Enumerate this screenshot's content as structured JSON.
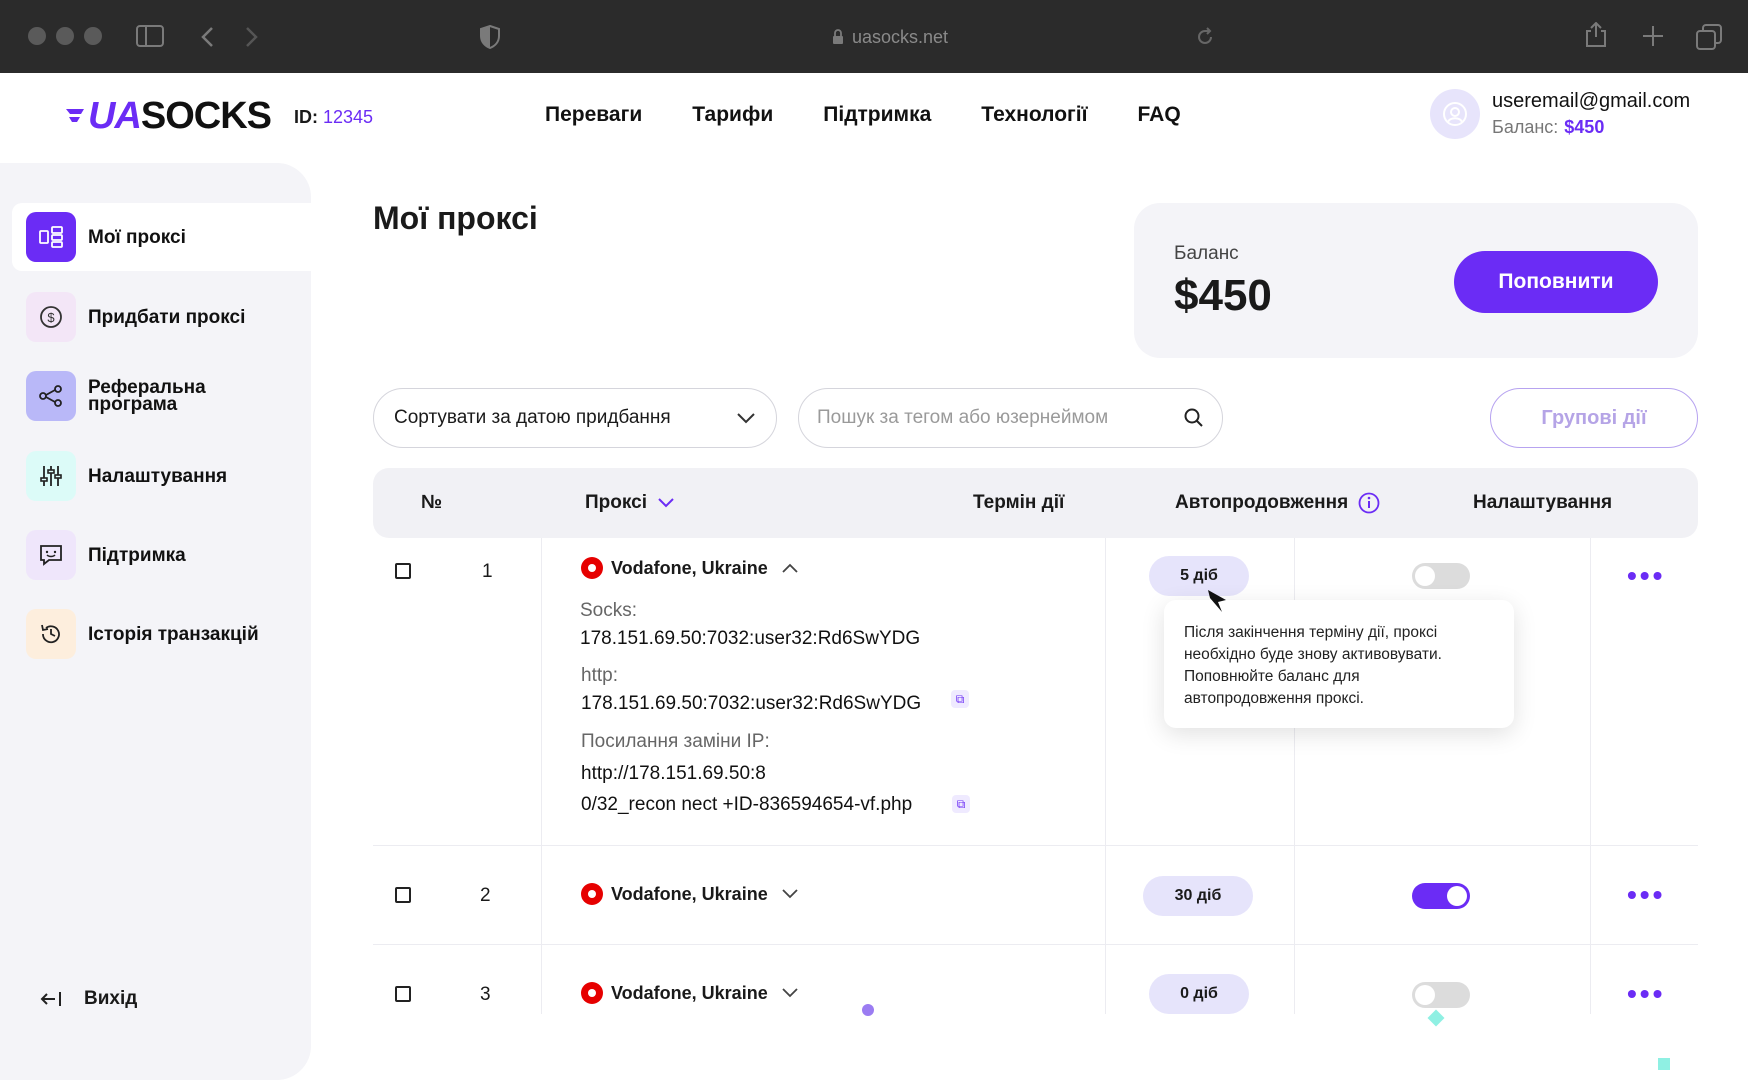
{
  "browser": {
    "url": "uasocks.net"
  },
  "header": {
    "logo_ua": "UA",
    "logo_socks": "SOCKS",
    "id_label": "ID:",
    "id_value": "12345",
    "nav": [
      "Переваги",
      "Тарифи",
      "Підтримка",
      "Технології",
      "FAQ"
    ],
    "user_email": "useremail@gmail.com",
    "balance_label": "Баланс:",
    "balance_value": "$450"
  },
  "sidebar": {
    "items": [
      {
        "label": "Мої проксі",
        "icon": "proxy-icon",
        "color": "#6b2cf5"
      },
      {
        "label": "Придбати проксі",
        "icon": "dollar-icon",
        "color": "#f3e6f7"
      },
      {
        "label": "Реферальна програма",
        "icon": "share-icon",
        "color": "#b9b8f8"
      },
      {
        "label": "Налаштування",
        "icon": "sliders-icon",
        "color": "#dcfbf8"
      },
      {
        "label": "Підтримка",
        "icon": "chat-icon",
        "color": "#efe6fb"
      },
      {
        "label": "Історія транзакцій",
        "icon": "history-icon",
        "color": "#fdeedd"
      }
    ],
    "logout": "Вихід"
  },
  "main": {
    "title": "Мої проксі",
    "balance_card": {
      "label": "Баланс",
      "amount": "$450",
      "topup_label": "Поповнити"
    },
    "sort_label": "Сортувати за датою придбання",
    "search_placeholder": "Пошук за тегом або юзернеймом",
    "group_actions": "Групові дії"
  },
  "table": {
    "headers": {
      "num": "№",
      "proxy": "Проксі",
      "term": "Термін дії",
      "autorenew": "Автопродовження",
      "settings": "Налаштування"
    },
    "rows": [
      {
        "num": "1",
        "provider": "Vodafone, Ukraine",
        "expanded": true,
        "days": "5 діб",
        "autorenew": false,
        "socks_label": "Socks:",
        "socks_value": "178.151.69.50:7032:user32:Rd6SwYDG",
        "http_label": "http:",
        "http_value": "178.151.69.50:7032:user32:Rd6SwYDG",
        "ip_change_label": "Посилання заміни IP:",
        "ip_change_line1": "http://178.151.69.50:8",
        "ip_change_line2": "0/32_recon nect +ID-836594654-vf.php"
      },
      {
        "num": "2",
        "provider": "Vodafone, Ukraine",
        "expanded": false,
        "days": "30 діб",
        "autorenew": true
      },
      {
        "num": "3",
        "provider": "Vodafone, Ukraine",
        "expanded": false,
        "days": "0 діб",
        "autorenew": false
      }
    ]
  },
  "tooltip": {
    "text_1": "Після закінчення терміну дії, проксі",
    "text_2": "необхідно буде знову активовувати.",
    "text_3": "Поповнюйте баланс для",
    "text_4": "автопродовження проксі."
  },
  "colors": {
    "accent": "#6b2cf5",
    "pill": "#e6e4fb",
    "sidebar_bg": "#f4f4f8"
  }
}
